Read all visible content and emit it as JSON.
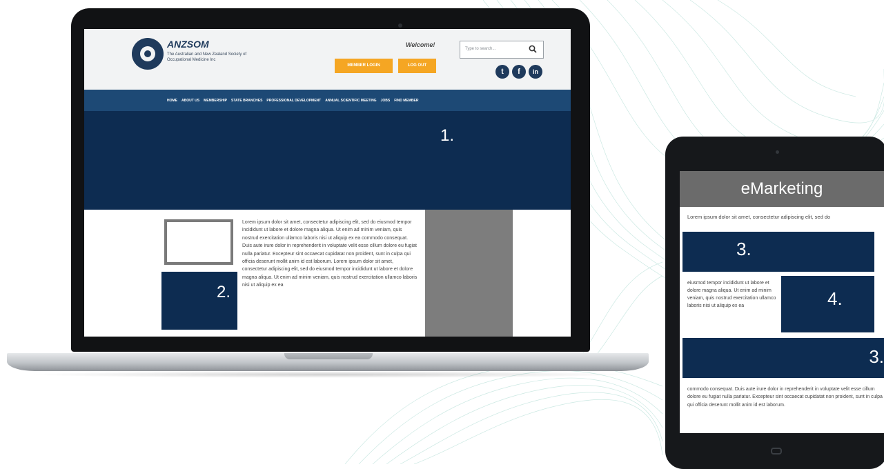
{
  "site": {
    "logo_name": "ANZSOM",
    "logo_subtitle": "The Australian and New Zealand Society of Occupational Medicine Inc",
    "welcome": "Welcome!",
    "member_login": "MEMBER LOGIN",
    "log_out": "LOG OUT",
    "search_placeholder": "Type to search...",
    "social": [
      "twitter-icon",
      "facebook-icon",
      "linkedin-icon"
    ]
  },
  "nav": {
    "items": [
      "HOME",
      "ABOUT US",
      "MEMBERSHIP",
      "STATE BRANCHES",
      "PROFESSIONAL DEVELOPMENT",
      "ANNUAL SCIENTIFIC MEETING",
      "JOBS",
      "FIND MEMBER"
    ]
  },
  "laptop": {
    "hero_number": "1.",
    "box_number": "2.",
    "body_text": "Lorem ipsum dolor sit amet, consectetur adipiscing elit, sed do eiusmod tempor incididunt ut labore et dolore magna aliqua. Ut enim ad minim veniam, quis nostrud exercitation ullamco laboris nisi ut aliquip ex ea commodo consequat. Duis aute irure dolor in reprehenderit in voluptate velit esse cillum dolore eu fugiat nulla pariatur. Excepteur sint occaecat cupidatat non proident, sunt in culpa qui officia deserunt mollit anim id est laborum. Lorem ipsum dolor sit amet, consectetur adipiscing elit, sed do eiusmod tempor incididunt ut labore et dolore magna aliqua. Ut enim ad minim veniam, quis nostrud exercitation ullamco laboris nisi ut aliquip ex ea"
  },
  "tablet": {
    "title": "eMarketing",
    "intro_text": "Lorem ipsum dolor sit amet, consectetur adipiscing elit, sed do",
    "box_3a": "3.",
    "side_text": "eiusmod tempor incididunt ut labore et dolore magna aliqua. Ut enim ad minim veniam, quis nostrud exercitation ullamco laboris nisi ut aliquip ex ea",
    "box_4": "4.",
    "box_3b": "3.",
    "footer_text": "commodo consequat. Duis aute irure dolor in reprehenderit in voluptate velit esse cillum dolore eu fugiat nulla pariatur. Excepteur sint occaecat cupidatat non proident, sunt in culpa qui officia deserunt mollit anim id est laborum."
  },
  "colors": {
    "navy": "#0d2c51",
    "nav_blue": "#1d4975",
    "orange": "#f5a623",
    "grey": "#7d7d7d"
  }
}
